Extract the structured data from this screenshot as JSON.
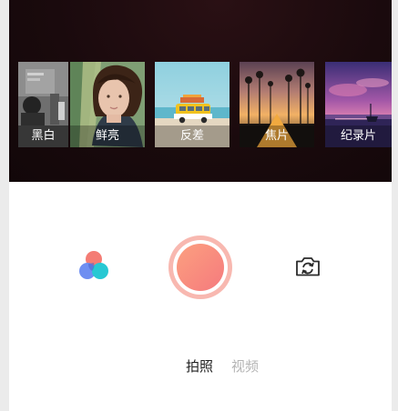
{
  "filters": [
    {
      "name": "黑白",
      "icon": "filter-thumb-mono-portrait",
      "selected": false
    },
    {
      "name": "鲜亮",
      "icon": "filter-thumb-woman-portrait",
      "selected": false
    },
    {
      "name": "反差",
      "icon": "filter-thumb-yellow-van",
      "selected": false
    },
    {
      "name": "焦片",
      "icon": "filter-thumb-sunset-road",
      "selected": false
    },
    {
      "name": "纪录片",
      "icon": "filter-thumb-lake-dusk",
      "selected": false
    }
  ],
  "controls": {
    "palette_icon": "color-palette-icon",
    "shutter_icon": "shutter-button",
    "switch_camera_icon": "camera-switch-icon"
  },
  "modes": {
    "photo": "拍照",
    "video": "视频",
    "active": "拍照"
  },
  "colors": {
    "preview_bg": "#1a0a0d",
    "shutter_gradient_start": "#fca07f",
    "shutter_gradient_end": "#f57a7e",
    "palette_red": "#f47c74",
    "palette_blue": "#6f8ff1",
    "palette_cyan": "#27c8d3",
    "mode_active": "#222222",
    "mode_inactive": "#b4b4b4"
  }
}
